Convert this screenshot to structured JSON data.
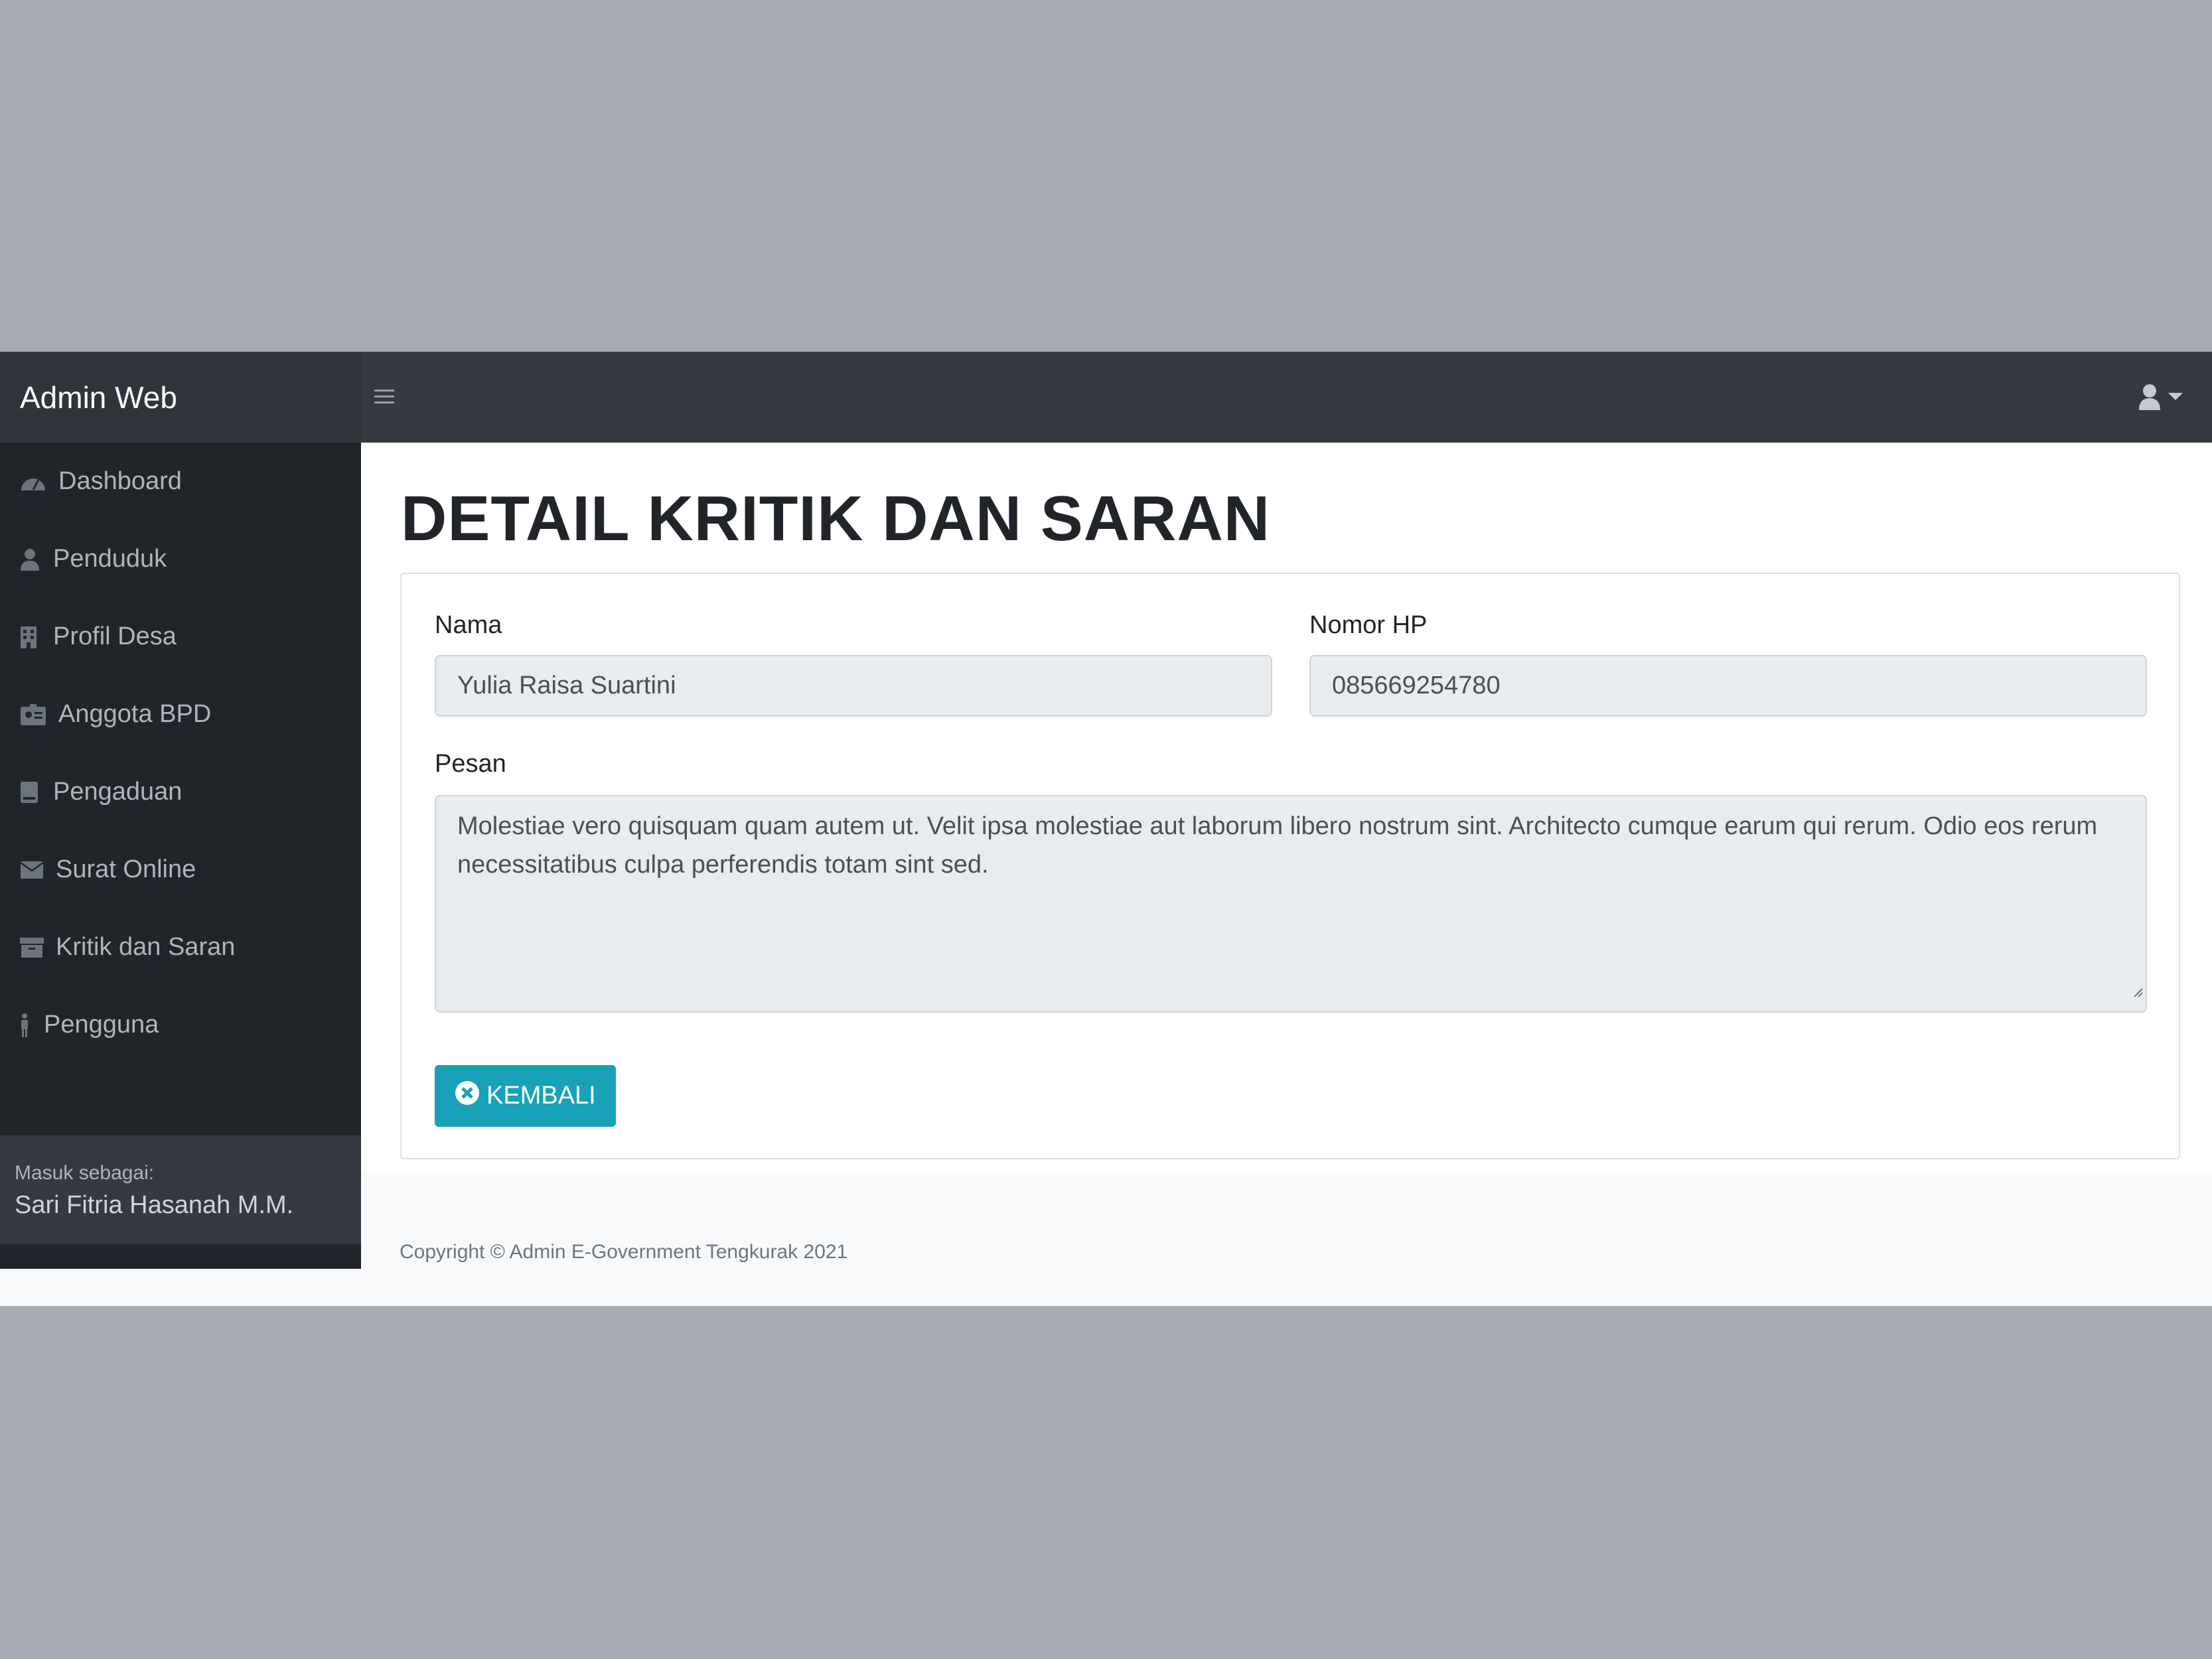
{
  "colors": {
    "navbar": "#343a40",
    "sidebar": "#212529",
    "accent": "#17a2b8",
    "backdrop": "#a7aab1"
  },
  "navbar": {
    "brand": "Admin Web",
    "toggle_icon": "hamburger-icon",
    "user_icon": "user-icon"
  },
  "sidebar": {
    "items": [
      {
        "label": "Dashboard",
        "icon": "tachometer-icon"
      },
      {
        "label": "Penduduk",
        "icon": "user-icon"
      },
      {
        "label": "Profil Desa",
        "icon": "building-icon"
      },
      {
        "label": "Anggota BPD",
        "icon": "id-badge-icon"
      },
      {
        "label": "Pengaduan",
        "icon": "book-icon"
      },
      {
        "label": "Surat Online",
        "icon": "envelope-icon"
      },
      {
        "label": "Kritik dan Saran",
        "icon": "archive-icon"
      },
      {
        "label": "Pengguna",
        "icon": "person-icon"
      }
    ],
    "footer_label": "Masuk sebagai:",
    "footer_user": "Sari Fitria Hasanah M.M."
  },
  "main": {
    "title": "DETAIL KRITIK DAN SARAN",
    "nama_label": "Nama",
    "nama_value": "Yulia Raisa Suartini",
    "hp_label": "Nomor HP",
    "hp_value": "085669254780",
    "pesan_label": "Pesan",
    "pesan_value": "Molestiae vero quisquam quam autem ut. Velit ipsa molestiae aut laborum libero nostrum sint. Architecto cumque earum qui rerum. Odio eos rerum necessitatibus culpa perferendis totam sint sed.",
    "back_button": "KEMBALI"
  },
  "footer": {
    "copyright": "Copyright © Admin E-Government Tengkurak 2021"
  }
}
